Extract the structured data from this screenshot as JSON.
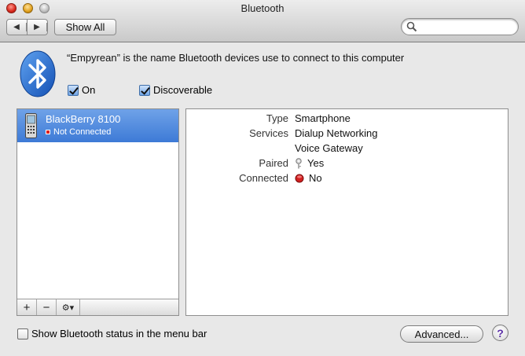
{
  "window": {
    "title": "Bluetooth"
  },
  "toolbar": {
    "back_icon": "chevron-left-icon",
    "forward_icon": "chevron-right-icon",
    "show_all_label": "Show All",
    "search_placeholder": "",
    "search_value": ""
  },
  "header": {
    "description": "“Empyrean” is the name Bluetooth devices use to connect to this computer",
    "on_label": "On",
    "on_checked": true,
    "discoverable_label": "Discoverable",
    "discoverable_checked": true
  },
  "device_list": {
    "items": [
      {
        "name": "BlackBerry 8100",
        "status": "Not Connected",
        "selected": true
      }
    ],
    "add_label": "+",
    "remove_label": "−",
    "gear_label": "⚙▾"
  },
  "details": {
    "type_label": "Type",
    "type_value": "Smartphone",
    "services_label": "Services",
    "services_values": [
      "Dialup Networking",
      "Voice Gateway"
    ],
    "paired_label": "Paired",
    "paired_value": "Yes",
    "connected_label": "Connected",
    "connected_value": "No"
  },
  "footer": {
    "status_menu_label": "Show Bluetooth status in the menu bar",
    "status_menu_checked": false,
    "advanced_label": "Advanced...",
    "help_label": "?"
  },
  "colors": {
    "selection": "#3d7ad6",
    "bluetooth_blue": "#1f63c6",
    "disconnected_red": "#d22020"
  }
}
